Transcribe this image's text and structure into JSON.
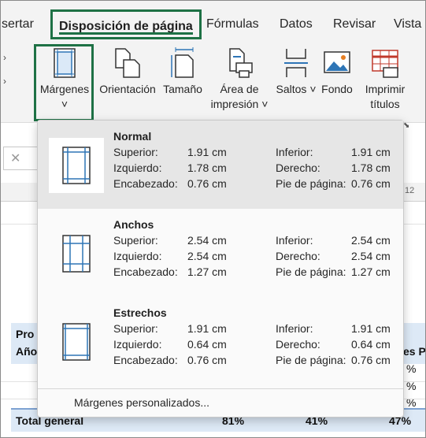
{
  "tabs": {
    "insert": "sertar",
    "page_layout": "Disposición de página",
    "formulas": "Fórmulas",
    "data": "Datos",
    "review": "Revisar",
    "view": "Vista"
  },
  "ribbon": {
    "margins": "Márgenes",
    "orientation": "Orientación",
    "size": "Tamaño",
    "print_area_1": "Área de",
    "print_area_2": "impresión",
    "breaks": "Saltos",
    "background": "Fondo",
    "print_titles_1": "Imprimir",
    "print_titles_2": "títulos"
  },
  "sheet": {
    "col_num": "12",
    "pro": "Pro",
    "ano": "Año",
    "es_p": "es P",
    "pct1": "%",
    "pct2": "%",
    "pct3": "%",
    "total_label": "Total general",
    "total_v1": "81%",
    "total_v2": "41%",
    "total_v3": "47%"
  },
  "margins_menu": {
    "options": [
      {
        "name": "Normal",
        "top_label": "Superior:",
        "top": "1.91 cm",
        "left_label": "Izquierdo:",
        "left": "1.78 cm",
        "header_label": "Encabezado:",
        "header": "0.76 cm",
        "bottom_label": "Inferior:",
        "bottom": "1.91 cm",
        "right_label": "Derecho:",
        "right": "1.78 cm",
        "footer_label": "Pie de página:",
        "footer": "0.76 cm"
      },
      {
        "name": "Anchos",
        "top_label": "Superior:",
        "top": "2.54 cm",
        "left_label": "Izquierdo:",
        "left": "2.54 cm",
        "header_label": "Encabezado:",
        "header": "1.27 cm",
        "bottom_label": "Inferior:",
        "bottom": "2.54 cm",
        "right_label": "Derecho:",
        "right": "2.54 cm",
        "footer_label": "Pie de página:",
        "footer": "1.27 cm"
      },
      {
        "name": "Estrechos",
        "top_label": "Superior:",
        "top": "1.91 cm",
        "left_label": "Izquierdo:",
        "left": "0.64 cm",
        "header_label": "Encabezado:",
        "header": "0.76 cm",
        "bottom_label": "Inferior:",
        "bottom": "1.91 cm",
        "right_label": "Derecho:",
        "right": "0.64 cm",
        "footer_label": "Pie de página:",
        "footer": "0.76 cm"
      }
    ],
    "custom": "Márgenes personalizados..."
  },
  "colors": {
    "accent_green": "#1e7145",
    "icon_blue": "#2e75b6",
    "icon_red": "#c0392b"
  }
}
